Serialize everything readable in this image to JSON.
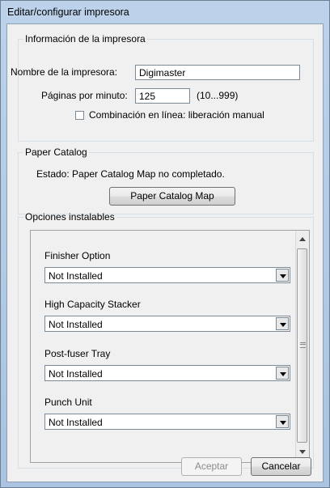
{
  "window": {
    "title": "Editar/configurar impresora"
  },
  "printer_info": {
    "legend": "Información de la impresora",
    "name_label": "Nombre de la impresora:",
    "name_value": "Digimaster",
    "ppm_label": "Páginas por minuto:",
    "ppm_value": "125",
    "ppm_range": "(10...999)",
    "inline_combination_label": "Combinación en línea: liberación manual",
    "inline_combination_checked": false
  },
  "paper_catalog": {
    "legend": "Paper Catalog",
    "status": "Estado: Paper Catalog Map no completado.",
    "map_button": "Paper Catalog Map"
  },
  "installable_options": {
    "legend": "Opciones instalables",
    "items": [
      {
        "label": "Finisher Option",
        "value": "Not Installed"
      },
      {
        "label": "High Capacity Stacker",
        "value": "Not Installed"
      },
      {
        "label": "Post-fuser Tray",
        "value": "Not Installed"
      },
      {
        "label": "Punch Unit",
        "value": "Not Installed"
      }
    ]
  },
  "buttons": {
    "accept": "Aceptar",
    "cancel": "Cancelar"
  },
  "icons": [
    "dropdown-arrow-icon",
    "scroll-up-icon",
    "scroll-down-icon",
    "scroll-grip-icon",
    "checkbox-icon"
  ],
  "colors": {
    "title_gradient_top": "#bcd2ea",
    "title_gradient_bottom": "#a9c3e0",
    "dialog_bg": "#f0f0f0",
    "disabled_text": "#8b8b8b"
  }
}
